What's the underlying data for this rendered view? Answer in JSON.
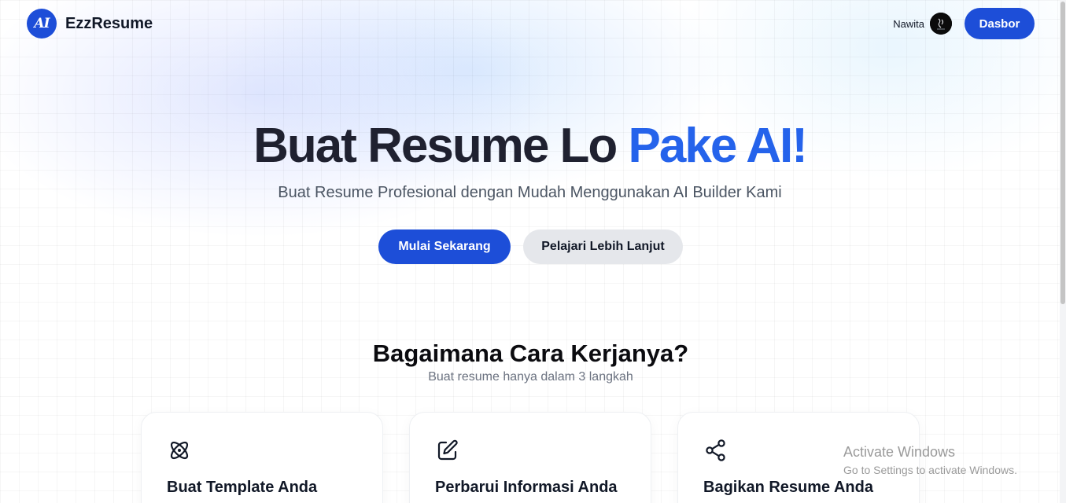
{
  "header": {
    "logo_mark": "AI",
    "brand": "EzzResume",
    "username": "Nawita",
    "dashboard_label": "Dasbor"
  },
  "hero": {
    "title_main": "Buat Resume Lo",
    "title_accent": "Pake AI!",
    "subtitle": "Buat Resume Profesional dengan Mudah Menggunakan AI Builder Kami",
    "primary_cta": "Mulai Sekarang",
    "secondary_cta": "Pelajari Lebih Lanjut"
  },
  "how": {
    "title": "Bagaimana Cara Kerjanya?",
    "subtitle": "Buat resume hanya dalam 3 langkah",
    "steps": [
      {
        "icon": "atom-icon",
        "title": "Buat Template Anda"
      },
      {
        "icon": "edit-icon",
        "title": "Perbarui Informasi Anda"
      },
      {
        "icon": "share-icon",
        "title": "Bagikan Resume Anda"
      }
    ]
  },
  "watermark": {
    "title": "Activate Windows",
    "subtitle": "Go to Settings to activate Windows."
  },
  "colors": {
    "primary": "#1d4ed8",
    "accent_text": "#2563eb",
    "secondary_button": "#e5e7eb"
  }
}
